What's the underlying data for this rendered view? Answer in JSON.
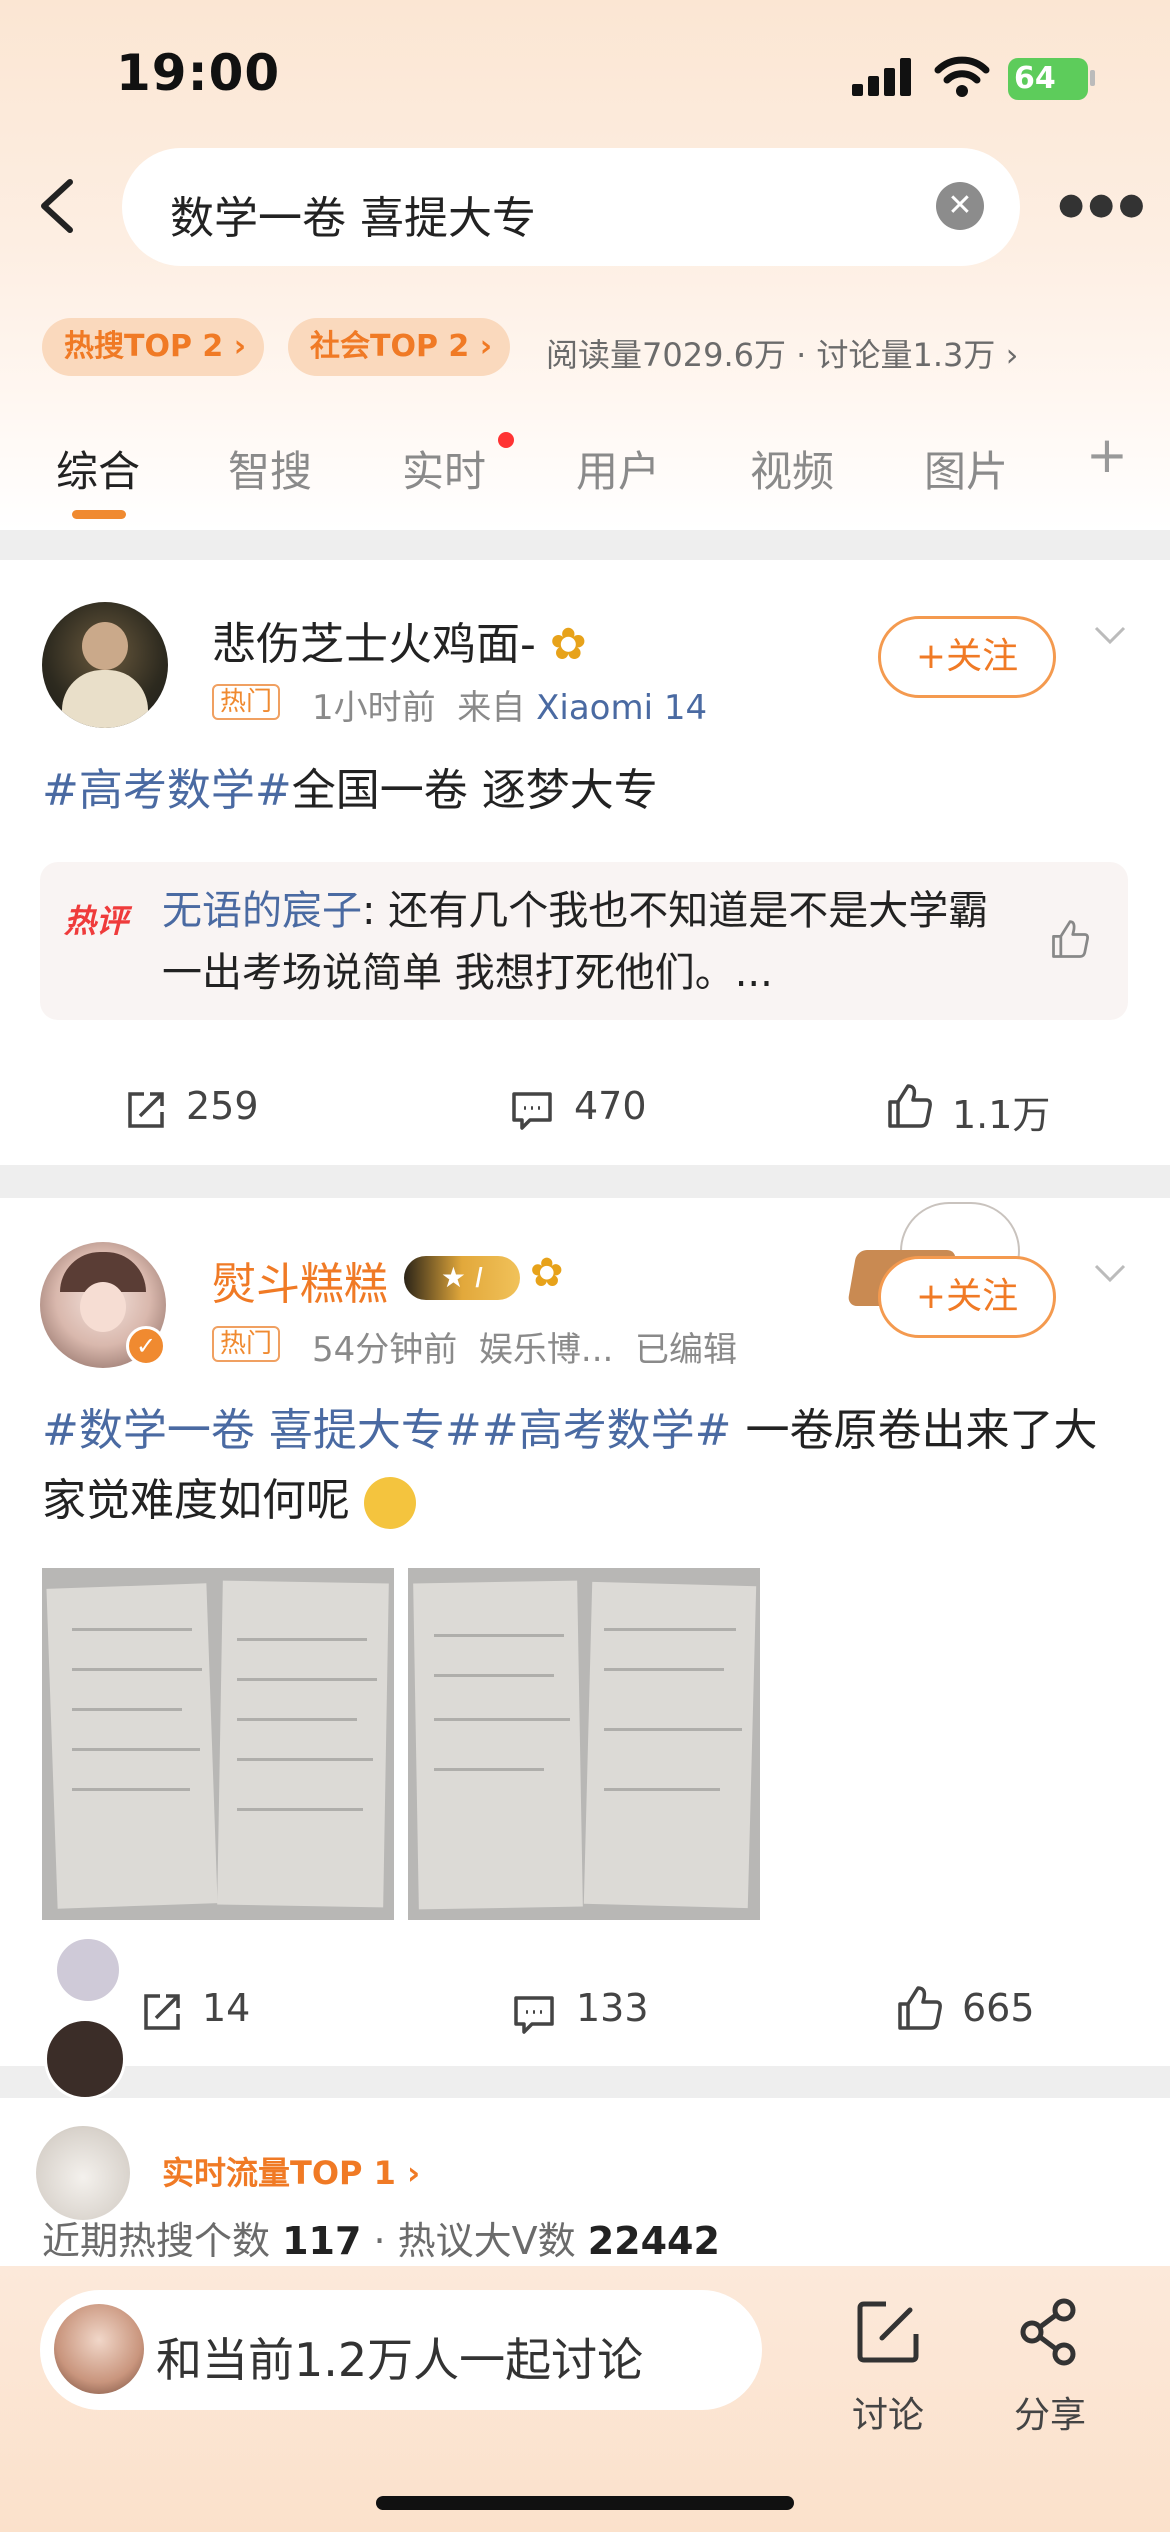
{
  "status_bar": {
    "time": "19:00",
    "battery": "64"
  },
  "search": {
    "query": "数学一卷 喜提大专"
  },
  "hot_pills": [
    {
      "label": "热搜TOP 2"
    },
    {
      "label": "社会TOP 2"
    }
  ],
  "stats_line": "阅读量7029.6万 · 讨论量1.3万",
  "tabs": [
    "综合",
    "智搜",
    "实时",
    "用户",
    "视频",
    "图片"
  ],
  "posts": [
    {
      "author": "悲伤芝士火鸡面-",
      "hot_tag": "热门",
      "time": "1小时前",
      "source_prefix": "来自",
      "source": "Xiaomi 14",
      "follow": "+关注",
      "topic": "#高考数学#",
      "text": "全国一卷 逐梦大专",
      "hot_comment": {
        "label": "热评",
        "user": "无语的宸子",
        "text": ": 还有几个我也不知道是不是大学霸 一出考场说简单 我想打死他们。..."
      },
      "reposts": "259",
      "comments": "470",
      "likes": "1.1万"
    },
    {
      "author": "熨斗糕糕",
      "hot_tag": "热门",
      "time": "54分钟前",
      "source": "娱乐博...",
      "edited": "已编辑",
      "follow": "+关注",
      "topic": "#数学一卷 喜提大专##高考数学#",
      "text": " 一卷原卷出来了大家觉难度如何呢",
      "reposts": "14",
      "comments": "133",
      "likes": "665"
    }
  ],
  "trend": {
    "link": "实时流量TOP 1",
    "stats_prefix": "近期热搜个数 ",
    "stats_count": "117",
    "stats_mid": " · 热议大V数 ",
    "stats_v": "22442"
  },
  "bottom_bar": {
    "discuss": "和当前1.2万人一起讨论",
    "discuss_btn": "讨论",
    "share_btn": "分享"
  },
  "colors": {
    "accent": "#f07a25",
    "link": "#4a6aa2",
    "hot": "#ef3b3b"
  }
}
